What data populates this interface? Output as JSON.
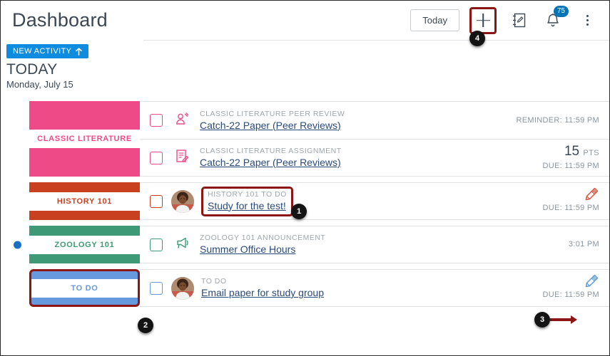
{
  "header": {
    "title": "Dashboard",
    "today_label": "Today",
    "add_icon": "plus-icon",
    "planner_note_icon": "notebook-edit-icon",
    "bell_icon": "bell-icon",
    "bell_badge": "75",
    "kebab_icon": "more-options-icon"
  },
  "subheader": {
    "new_activity_label": "NEW ACTIVITY",
    "new_activity_arrow": "arrow-up-icon",
    "day_title": "TODAY",
    "day_subtitle": "Monday, July 15"
  },
  "colors": {
    "classic_literature": "#EF4A88",
    "history": "#C8401F",
    "zoology": "#3E9A76",
    "todo": "#6699DD",
    "link": "#2a4a7a",
    "highlight": "#8c1515",
    "badge_blue": "#0374B5",
    "new_activity_blue": "#0E8CE0"
  },
  "groups": [
    {
      "card_label": "CLASSIC LITERATURE",
      "card_color": "#EF4A88",
      "card_highlighted": false,
      "unread_dot": false,
      "rows": [
        {
          "checkbox_checked": false,
          "icon": "peer-review-icon",
          "eyebrow": "CLASSIC LITERATURE PEER REVIEW",
          "link": "Catch-22 Paper (Peer Reviews)",
          "meta_primary": "",
          "meta_secondary": "REMINDER: 11:59 PM",
          "points": "",
          "points_unit": "",
          "avatar": false,
          "pencil": false,
          "highlight_text": false
        },
        {
          "checkbox_checked": false,
          "icon": "assignment-icon",
          "eyebrow": "CLASSIC LITERATURE ASSIGNMENT",
          "link": "Catch-22 Paper (Peer Reviews)",
          "meta_primary": "",
          "meta_secondary": "DUE: 11:59 PM",
          "points": "15",
          "points_unit": "PTS",
          "avatar": false,
          "pencil": false,
          "highlight_text": false
        }
      ]
    },
    {
      "card_label": "HISTORY 101",
      "card_color": "#C8401F",
      "card_highlighted": false,
      "unread_dot": false,
      "rows": [
        {
          "checkbox_checked": false,
          "icon": "",
          "eyebrow": "HISTORY 101 TO DO",
          "link": "Study for the test!",
          "meta_primary": "",
          "meta_secondary": "DUE: 11:59 PM",
          "points": "",
          "points_unit": "",
          "avatar": true,
          "pencil": "red",
          "highlight_text": true
        }
      ]
    },
    {
      "card_label": "ZOOLOGY 101",
      "card_color": "#3E9A76",
      "card_highlighted": false,
      "unread_dot": true,
      "rows": [
        {
          "checkbox_checked": false,
          "icon": "announcement-icon",
          "eyebrow": "ZOOLOGY 101 ANNOUNCEMENT",
          "link": "Summer Office Hours",
          "meta_primary": "",
          "meta_secondary": "3:01 PM",
          "points": "",
          "points_unit": "",
          "avatar": false,
          "pencil": false,
          "highlight_text": false
        }
      ]
    },
    {
      "card_label": "TO DO",
      "card_color": "#6699DD",
      "card_highlighted": true,
      "unread_dot": false,
      "rows": [
        {
          "checkbox_checked": false,
          "icon": "",
          "eyebrow": "TO DO",
          "link": "Email paper for study group",
          "meta_primary": "",
          "meta_secondary": "DUE: 11:59 PM",
          "points": "",
          "points_unit": "",
          "avatar": true,
          "pencil": "blue",
          "highlight_text": false
        }
      ]
    }
  ],
  "markers": [
    {
      "num": "1"
    },
    {
      "num": "2"
    },
    {
      "num": "3"
    },
    {
      "num": "4"
    }
  ]
}
